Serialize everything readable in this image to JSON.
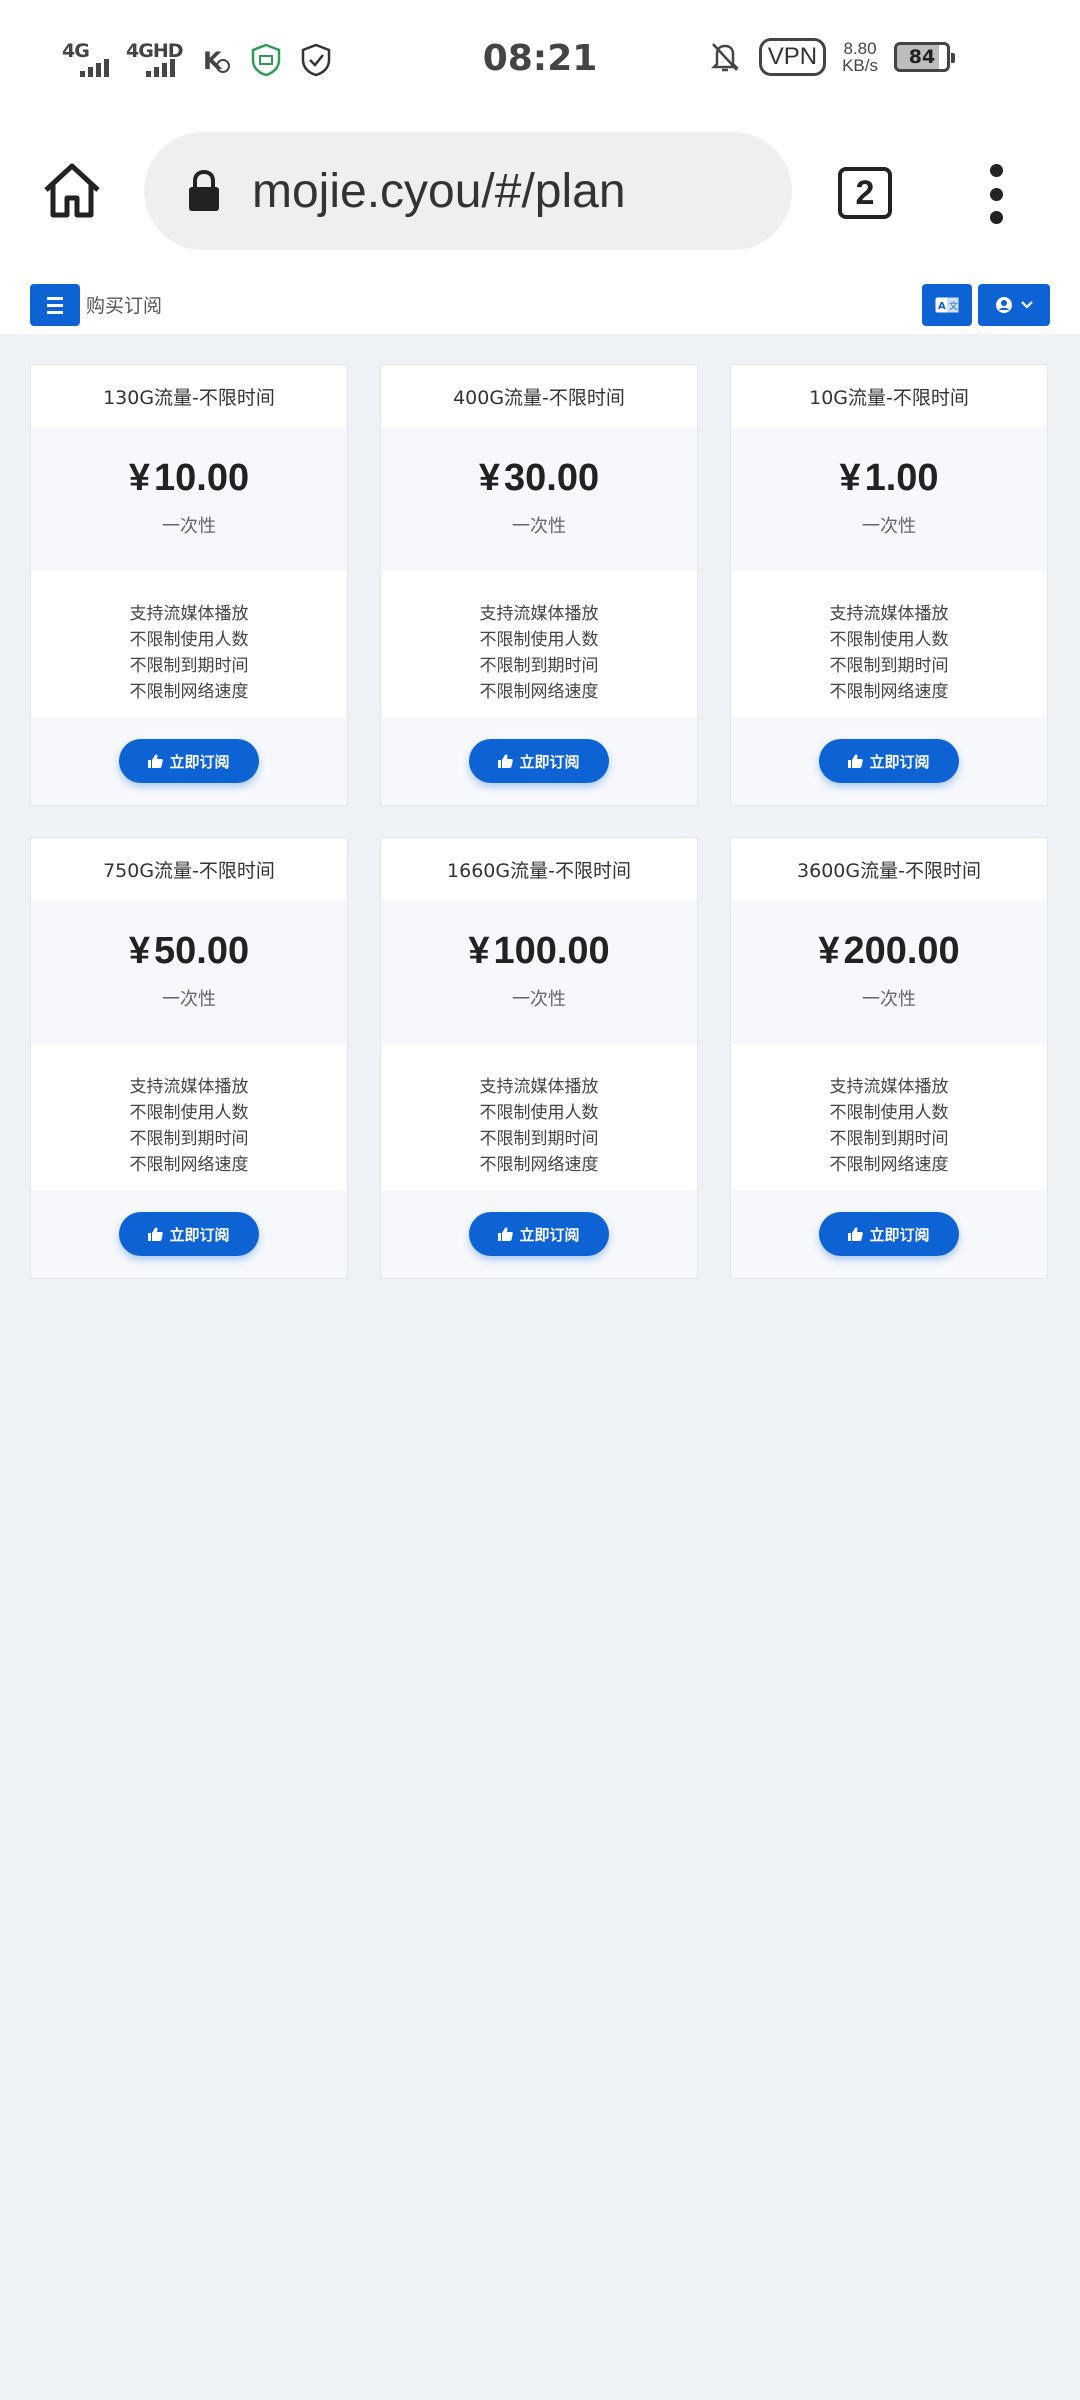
{
  "status_bar": {
    "network1": "4G",
    "network2": "4GHD",
    "time": "08:21",
    "vpn": "VPN",
    "speed_value": "8.80",
    "speed_unit": "KB/s",
    "battery": "84"
  },
  "browser": {
    "url": "mojie.cyou/#/plan",
    "tab_count": "2"
  },
  "header": {
    "breadcrumb": "购买订阅"
  },
  "currency": "¥",
  "subscribe_label": "立即订阅",
  "plans": [
    {
      "title": "130G流量-不限时间",
      "price": "10.00",
      "period": "一次性",
      "features": [
        "支持流媒体播放",
        "不限制使用人数",
        "不限制到期时间",
        "不限制网络速度"
      ]
    },
    {
      "title": "400G流量-不限时间",
      "price": "30.00",
      "period": "一次性",
      "features": [
        "支持流媒体播放",
        "不限制使用人数",
        "不限制到期时间",
        "不限制网络速度"
      ]
    },
    {
      "title": "10G流量-不限时间",
      "price": "1.00",
      "period": "一次性",
      "features": [
        "支持流媒体播放",
        "不限制使用人数",
        "不限制到期时间",
        "不限制网络速度"
      ]
    },
    {
      "title": "750G流量-不限时间",
      "price": "50.00",
      "period": "一次性",
      "features": [
        "支持流媒体播放",
        "不限制使用人数",
        "不限制到期时间",
        "不限制网络速度"
      ]
    },
    {
      "title": "1660G流量-不限时间",
      "price": "100.00",
      "period": "一次性",
      "features": [
        "支持流媒体播放",
        "不限制使用人数",
        "不限制到期时间",
        "不限制网络速度"
      ]
    },
    {
      "title": "3600G流量-不限时间",
      "price": "200.00",
      "period": "一次性",
      "features": [
        "支持流媒体播放",
        "不限制使用人数",
        "不限制到期时间",
        "不限制网络速度"
      ]
    }
  ],
  "colors": {
    "accent": "#0d63d4",
    "page_bg": "#eef1f6",
    "card_band": "#f6f8fc"
  }
}
